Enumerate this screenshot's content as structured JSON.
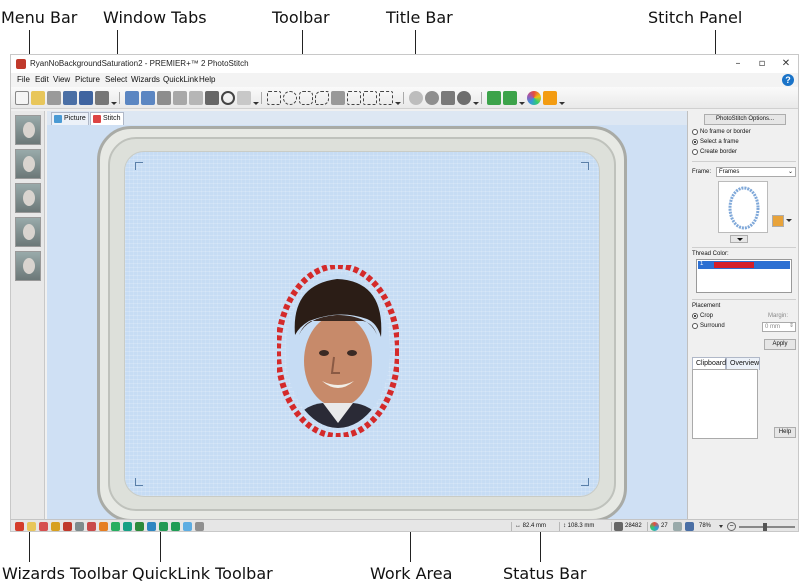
{
  "callouts": {
    "menu_bar": "Menu Bar",
    "window_tabs": "Window Tabs",
    "toolbar": "Toolbar",
    "title_bar": "Title Bar",
    "stitch_panel": "Stitch Panel",
    "wizards_toolbar": "Wizards Toolbar",
    "quicklink_toolbar": "QuickLink Toolbar",
    "work_area": "Work Area",
    "status_bar": "Status Bar"
  },
  "window": {
    "title": "RyanNoBackgroundSaturation2 - PREMIER+™ 2 PhotoStitch",
    "minimize": "–",
    "restore": "▫",
    "close": "✕"
  },
  "menu": [
    "File",
    "Edit",
    "View",
    "Picture",
    "Select",
    "Wizards",
    "QuickLink",
    "Help"
  ],
  "tabs": [
    {
      "label": "Picture",
      "icon": "picture-icon"
    },
    {
      "label": "Stitch",
      "icon": "stitch-icon"
    }
  ],
  "panel": {
    "options_button": "PhotoStitch Options...",
    "frame_options": [
      "No frame or border",
      "Select a frame",
      "Create border"
    ],
    "frame_selected": 1,
    "frame_label": "Frame:",
    "frame_value": "Frames",
    "thread_color_label": "Thread Color:",
    "thread_index": "1",
    "placement_label": "Placement",
    "placement_options": [
      "Crop",
      "Surround"
    ],
    "placement_selected": 0,
    "margin_label": "Margin:",
    "margin_value": "0 mm",
    "apply_button": "Apply",
    "subtabs": [
      "Clipboard",
      "Overview"
    ],
    "help_button": "Help"
  },
  "status": {
    "width": "↔ 82.4 mm",
    "height": "↕ 108.3 mm",
    "stitches": "28482",
    "colors": "27",
    "zoom": "78%"
  },
  "colors": {
    "accent": "#1a73c8",
    "work_bg": "#cfe0f4",
    "frame_red": "#d42a2a"
  }
}
